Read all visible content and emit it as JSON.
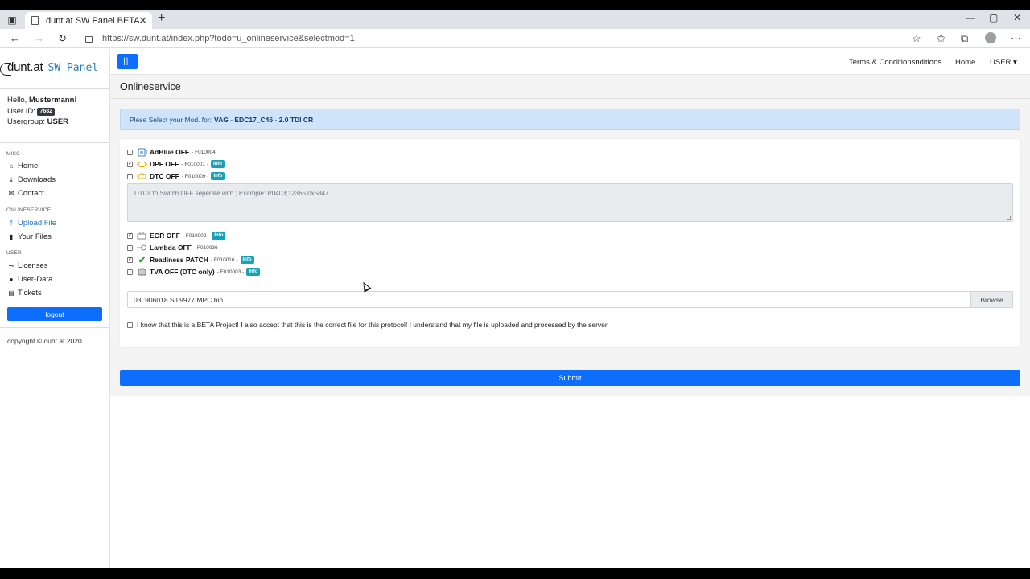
{
  "browser": {
    "tab_title": "dunt.at SW Panel BETA",
    "tab_close": "✕",
    "new_tab": "+",
    "url": "https://sw.dunt.at/index.php?todo=u_onlineservice&selectmod=1",
    "win_min": "—",
    "win_max": "▢",
    "win_close": "✕"
  },
  "sidebar": {
    "brand_name": "dunt.at",
    "brand_suffix": "SW Panel",
    "user_hello": "Hello,",
    "user_name": "Mustermann!",
    "user_id_label": "User ID:",
    "user_id": "7682",
    "usergroup_label": "Usergroup:",
    "usergroup": "USER",
    "section_misc": "MISC",
    "section_online": "ONLINESERVICE",
    "section_user": "USER",
    "items": [
      {
        "label": "Home"
      },
      {
        "label": "Downloads"
      },
      {
        "label": "Contact"
      },
      {
        "label": "Upload File"
      },
      {
        "label": "Your Files"
      },
      {
        "label": "Licenses"
      },
      {
        "label": "User-Data"
      },
      {
        "label": "Tickets"
      }
    ],
    "logout": "logout",
    "copyright": "copyright © dunt.at 2020"
  },
  "topnav": {
    "toggle": "|||",
    "terms": "Terms & Conditionsnditions",
    "home": "Home",
    "user": "USER ▾"
  },
  "main": {
    "title": "Onlineservice",
    "alert_prefix": "Plese Select your Mod. for:",
    "alert_vehicle": "VAG - EDC17_C46 - 2.0 TDI CR",
    "options": [
      {
        "name": "AdBlue OFF",
        "code": "- F010004",
        "checked": false,
        "info": false
      },
      {
        "name": "DPF OFF",
        "code": "- F010001 -",
        "checked": true,
        "info": true
      },
      {
        "name": "DTC OFF",
        "code": "- F010009 -",
        "checked": false,
        "info": true
      },
      {
        "name": "EGR OFF",
        "code": "- F010002 -",
        "checked": true,
        "info": true
      },
      {
        "name": "Lambda OFF",
        "code": "- F010036",
        "checked": false,
        "info": false
      },
      {
        "name": "Readiness PATCH",
        "code": "- F010016 -",
        "checked": true,
        "info": true
      },
      {
        "name": "TVA OFF (DTC only)",
        "code": "- F010003 -",
        "checked": false,
        "info": true
      }
    ],
    "info_label": "Info",
    "dtc_placeholder": "DTCs to Switch OFF seperate with ; Example: P0403;12365;0x5847",
    "file_name": "03L906018 SJ 9977.MPC.bin",
    "browse": "Browse",
    "agree_text": "I know that this is a BETA Project! I also accept that this is the correct file for this protocol! I understand that my file is uploaded and processed by the server.",
    "submit": "Submit"
  },
  "colors": {
    "primary": "#0d6efd",
    "info": "#17a2b8",
    "alert_bg": "#cfe4fb"
  }
}
